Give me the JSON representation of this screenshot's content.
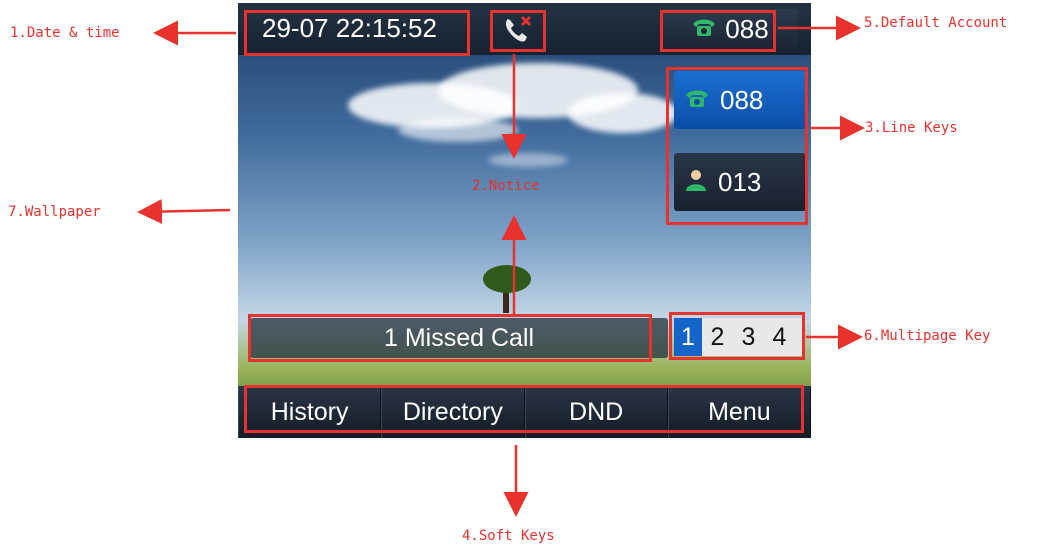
{
  "screen": {
    "datetime": "29-07 22:15:52",
    "default_account": "088",
    "line_keys": [
      {
        "label": "088",
        "icon": "phone-icon",
        "active": true
      },
      {
        "label": "013",
        "icon": "contact-icon",
        "active": false
      }
    ],
    "missed_call": "1 Missed Call",
    "pages": [
      "1",
      "2",
      "3",
      "4"
    ],
    "active_page": "1",
    "soft_keys": [
      "History",
      "Directory",
      "DND",
      "Menu"
    ]
  },
  "annotations": {
    "date_time": "1.Date & time",
    "notice": "2.Notice",
    "line_keys": "3.Line Keys",
    "soft_keys": "4.Soft Keys",
    "default_account": "5.Default Account",
    "multipage": "6.Multipage Key",
    "wallpaper": "7.Wallpaper"
  },
  "colors": {
    "annotation": "#e8322e",
    "active_key": "#1565c8",
    "phone_icon": "#2fb86a"
  }
}
